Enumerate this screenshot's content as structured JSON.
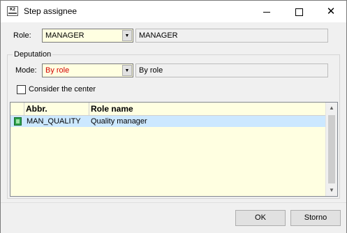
{
  "window": {
    "title": "Step assignee",
    "app_icon_text": "K2"
  },
  "role": {
    "label": "Role:",
    "value": "MANAGER",
    "display_value": "MANAGER"
  },
  "deputation": {
    "group_title": "Deputation",
    "mode_label": "Mode:",
    "mode_value": "By role",
    "mode_display": "By role",
    "consider_center_label": "Consider the center",
    "consider_center_checked": false
  },
  "grid": {
    "columns": [
      "Abbr.",
      "Role name"
    ],
    "rows": [
      {
        "abbr": "MAN_QUALITY",
        "role_name": "Quality manager",
        "selected": true
      }
    ]
  },
  "buttons": {
    "ok_label": "OK",
    "storno_label": "Storno"
  },
  "colors": {
    "combo_bg": "#ffffe1",
    "selected_row": "#cce8ff",
    "mode_text": "#d40000"
  }
}
